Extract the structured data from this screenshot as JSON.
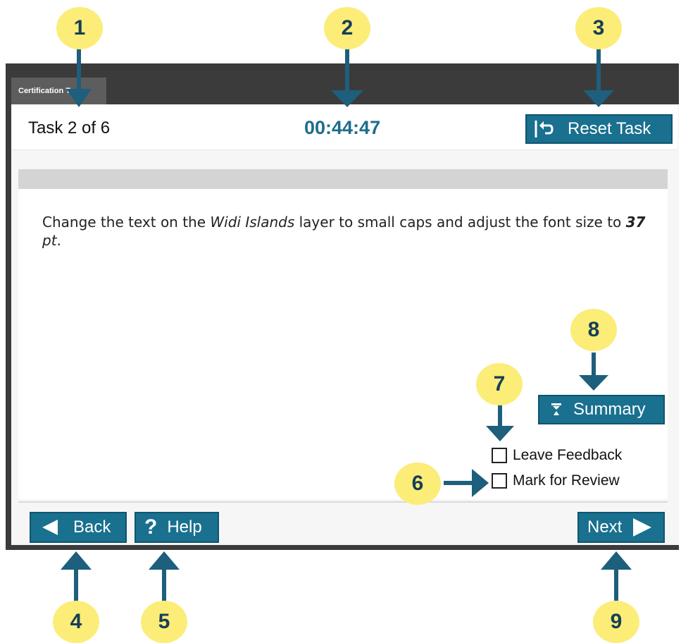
{
  "tab": {
    "label": "Certification Test"
  },
  "header": {
    "task_counter": "Task 2 of 6",
    "timer": "00:44:47",
    "reset_label": "Reset Task"
  },
  "instruction": {
    "part1": "Change the text on the ",
    "layer_name": "Widi Islands",
    "part2": " layer to small caps and adjust the font size to ",
    "size_value": "37",
    "size_unit": " pt",
    "end": "."
  },
  "summary_label": "Summary",
  "checkboxes": {
    "leave_feedback": "Leave Feedback",
    "mark_review": "Mark for Review"
  },
  "footer": {
    "back_label": "Back",
    "help_label": "Help",
    "next_label": "Next"
  },
  "callouts": [
    "1",
    "2",
    "3",
    "4",
    "5",
    "6",
    "7",
    "8",
    "9"
  ],
  "colors": {
    "button": "#19708f",
    "timer": "#1e6d8c",
    "callout": "#fbed78",
    "arrow": "#1d5f7c"
  }
}
